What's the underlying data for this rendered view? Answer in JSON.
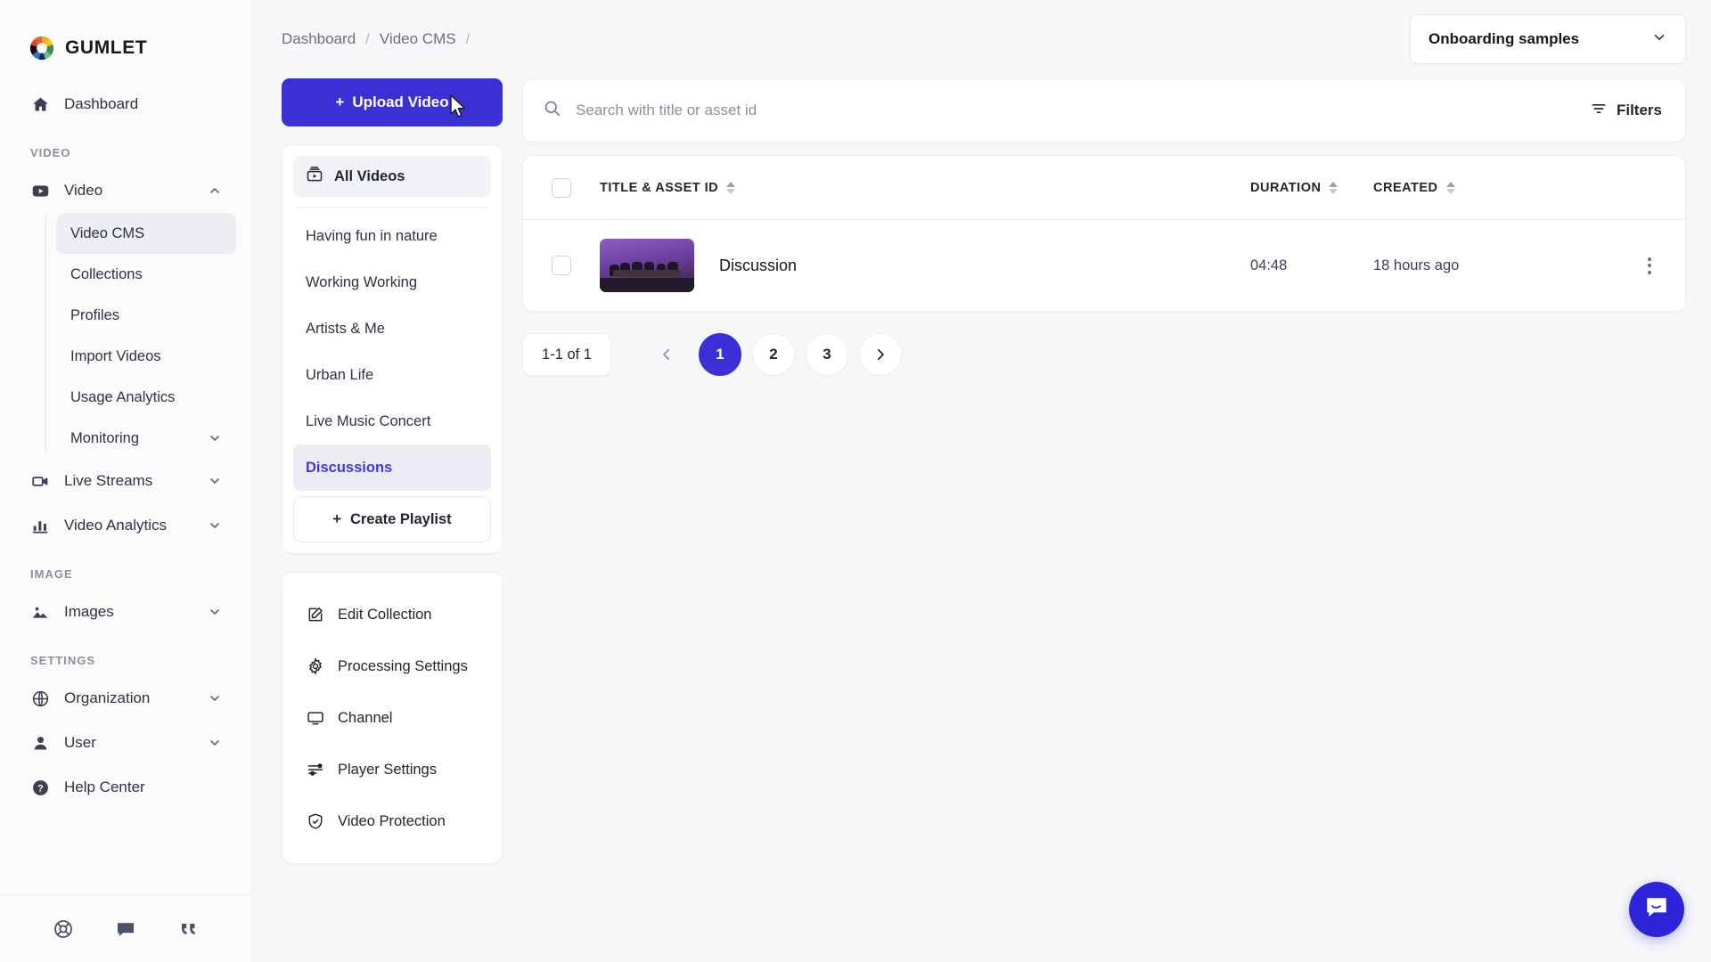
{
  "brand": {
    "name": "GUMLET",
    "accent": "#3b30d6"
  },
  "sidebar": {
    "dashboard": {
      "label": "Dashboard",
      "icon": "home-icon"
    },
    "sections": [
      {
        "label": "VIDEO"
      },
      {
        "label": "IMAGE"
      },
      {
        "label": "SETTINGS"
      }
    ],
    "video_group": {
      "label": "Video",
      "icon": "video-play-icon",
      "chevron": "chevron-up-icon"
    },
    "video_items": [
      {
        "label": "Video CMS",
        "active": true
      },
      {
        "label": "Collections",
        "active": false
      },
      {
        "label": "Profiles",
        "active": false
      },
      {
        "label": "Import Videos",
        "active": false
      },
      {
        "label": "Usage Analytics",
        "active": false
      },
      {
        "label": "Monitoring",
        "active": false,
        "chevron": "chevron-down-icon"
      }
    ],
    "live_streams": {
      "label": "Live Streams",
      "icon": "video-camera-icon",
      "chevron": "chevron-down-icon"
    },
    "video_analytics": {
      "label": "Video Analytics",
      "icon": "bar-chart-icon",
      "chevron": "chevron-down-icon"
    },
    "images": {
      "label": "Images",
      "icon": "image-icon",
      "chevron": "chevron-down-icon"
    },
    "organization": {
      "label": "Organization",
      "icon": "globe-icon",
      "chevron": "chevron-down-icon"
    },
    "user": {
      "label": "User",
      "icon": "person-icon",
      "chevron": "chevron-down-icon"
    },
    "help_center": {
      "label": "Help Center",
      "icon": "question-circle-icon"
    },
    "footer_icons": [
      "lifebuoy-icon",
      "chat-icon",
      "quote-icon"
    ]
  },
  "header": {
    "breadcrumbs": [
      "Dashboard",
      "Video CMS"
    ],
    "separator": "/",
    "org_select": {
      "value": "Onboarding samples",
      "icon": "chevron-down-icon"
    }
  },
  "left_panel": {
    "upload_button": {
      "label": "Upload Video",
      "plus": "+"
    },
    "all_videos": {
      "label": "All Videos",
      "icon": "all-videos-icon"
    },
    "playlists": [
      {
        "label": "Having fun in nature",
        "active": false
      },
      {
        "label": "Working Working",
        "active": false
      },
      {
        "label": "Artists & Me",
        "active": false
      },
      {
        "label": "Urban Life",
        "active": false
      },
      {
        "label": "Live Music Concert",
        "active": false
      },
      {
        "label": "Discussions",
        "active": true
      }
    ],
    "create_playlist": {
      "label": "Create Playlist",
      "plus": "+"
    },
    "settings_items": [
      {
        "label": "Edit Collection",
        "icon": "edit-square-icon"
      },
      {
        "label": "Processing Settings",
        "icon": "gear-icon"
      },
      {
        "label": "Channel",
        "icon": "monitor-icon"
      },
      {
        "label": "Player Settings",
        "icon": "sliders-icon"
      },
      {
        "label": "Video Protection",
        "icon": "shield-check-icon"
      }
    ]
  },
  "search": {
    "placeholder": "Search with title or asset id",
    "value": "",
    "icon": "search-icon",
    "filters_label": "Filters",
    "filters_icon": "filter-icon"
  },
  "table": {
    "columns": [
      {
        "label": "TITLE & ASSET ID",
        "sortable": true
      },
      {
        "label": "DURATION",
        "sortable": true
      },
      {
        "label": "CREATED",
        "sortable": true
      }
    ],
    "rows": [
      {
        "title": "Discussion",
        "duration": "04:48",
        "created": "18 hours ago",
        "thumbnail": "discussion-thumbnail",
        "menu_icon": "kebab-menu-icon"
      }
    ]
  },
  "pagination": {
    "count_label": "1-1 of 1",
    "prev_icon": "chevron-left-icon",
    "next_icon": "chevron-right-icon",
    "pages": [
      "1",
      "2",
      "3"
    ],
    "current_page": "1"
  },
  "chat_widget": {
    "icon": "intercom-chat-icon"
  }
}
